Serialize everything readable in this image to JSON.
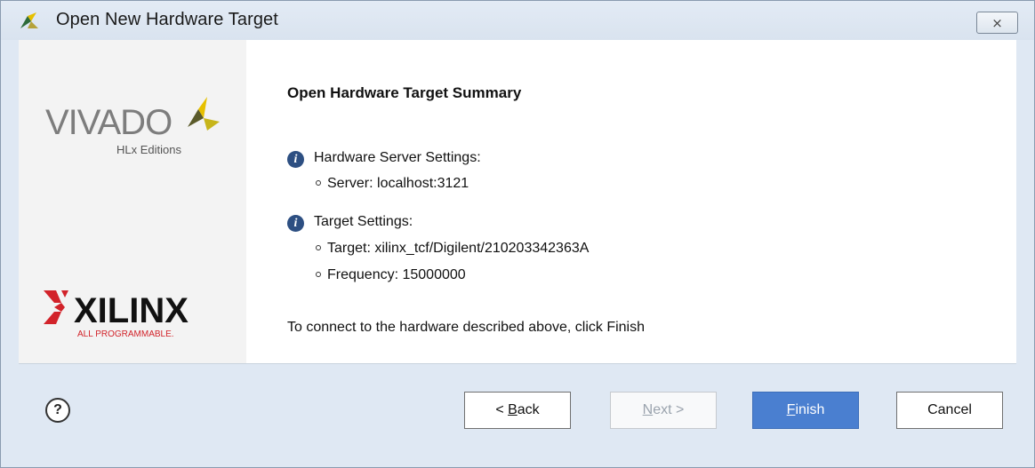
{
  "window": {
    "title": "Open New Hardware Target",
    "close_glyph": "⨯"
  },
  "branding": {
    "vivado_text": "VIVADO",
    "vivado_sub": "HLx Editions",
    "xilinx_text": "XILINX",
    "xilinx_sub": "ALL PROGRAMMABLE."
  },
  "summary": {
    "heading": "Open Hardware Target Summary",
    "sections": [
      {
        "title": "Hardware Server Settings:",
        "items": [
          "Server: localhost:3121"
        ]
      },
      {
        "title": "Target Settings:",
        "items": [
          "Target: xilinx_tcf/Digilent/210203342363A",
          "Frequency: 15000000"
        ]
      }
    ],
    "footer": "To connect to the hardware described above, click Finish"
  },
  "buttons": {
    "help": "?",
    "back_prefix": "< ",
    "back_mnemonic": "B",
    "back_rest": "ack",
    "next_mnemonic": "N",
    "next_rest": "ext >",
    "finish_mnemonic": "F",
    "finish_rest": "inish",
    "cancel": "Cancel"
  },
  "colors": {
    "accent": "#4a7fd0",
    "info_icon": "#2d4f82",
    "xilinx_red": "#d2232a",
    "vivado_gold": "#c7b51a"
  },
  "icons": {
    "title_icon": "vivado-logo-icon",
    "info_icon": "info-icon",
    "help_icon": "help-icon",
    "close_icon": "close-icon"
  }
}
